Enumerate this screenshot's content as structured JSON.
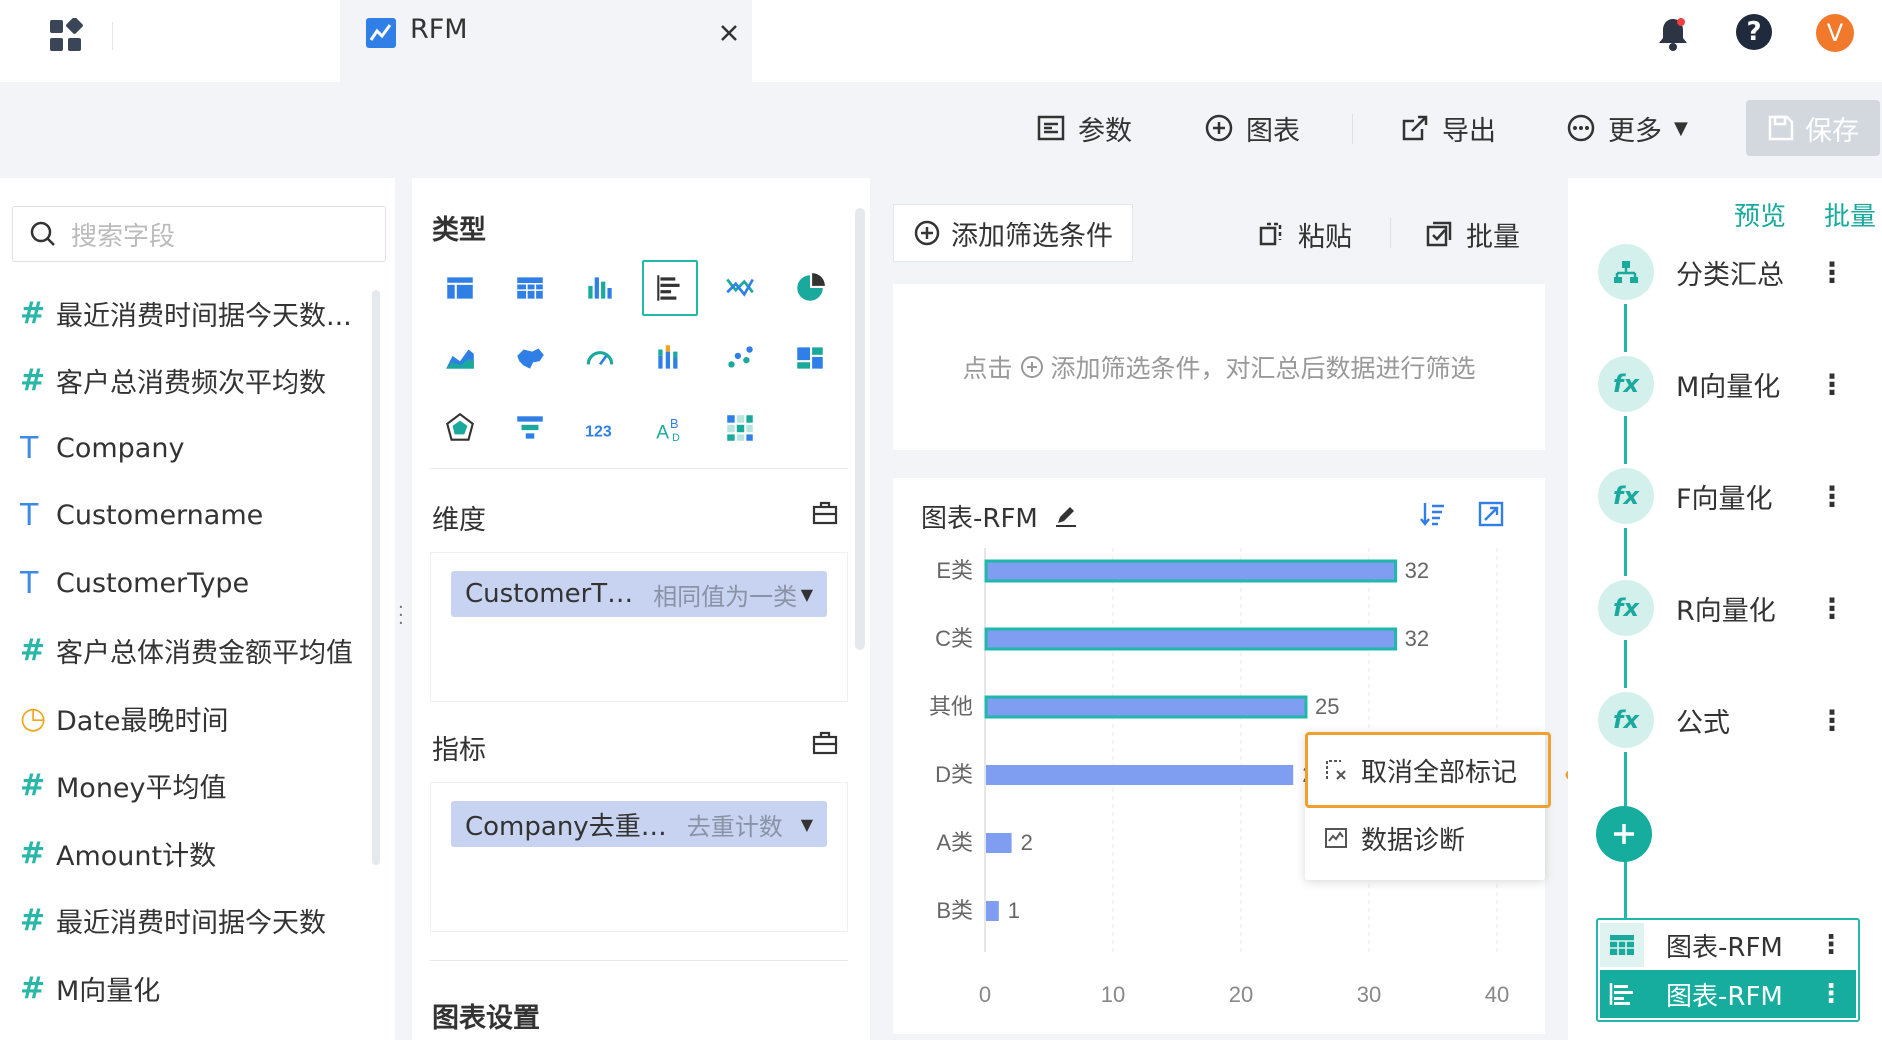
{
  "tab": {
    "title": "RFM"
  },
  "user": {
    "avatar_letter": "V"
  },
  "toolbar": {
    "params_label": "参数",
    "chart_label": "图表",
    "export_label": "导出",
    "more_label": "更多",
    "save_label": "保存"
  },
  "search": {
    "placeholder": "搜索字段"
  },
  "fields": [
    {
      "type": "number",
      "label": "最近消费时间据今天数..."
    },
    {
      "type": "number",
      "label": "客户总消费频次平均数"
    },
    {
      "type": "text-geo",
      "label": "Company"
    },
    {
      "type": "text",
      "label": "Customername"
    },
    {
      "type": "text-geo",
      "label": "CustomerType"
    },
    {
      "type": "number",
      "label": "客户总体消费金额平均值"
    },
    {
      "type": "date",
      "label": "Date最晚时间"
    },
    {
      "type": "number",
      "label": "Money平均值"
    },
    {
      "type": "number",
      "label": "Amount计数"
    },
    {
      "type": "number",
      "label": "最近消费时间据今天数"
    },
    {
      "type": "number",
      "label": "M向量化"
    }
  ],
  "middle": {
    "type_title": "类型",
    "dimension_title": "维度",
    "dimension_pill": {
      "main": "CustomerT…",
      "sub": "相同值为一类"
    },
    "metric_title": "指标",
    "metric_pill": {
      "main": "Company去重…",
      "sub": "去重计数"
    },
    "chart_settings_title": "图表设置"
  },
  "filter": {
    "add_label": "添加筛选条件",
    "paste_label": "粘贴",
    "batch_label": "批量",
    "hint_prefix": "点击",
    "hint_suffix": "添加筛选条件，对汇总后数据进行筛选"
  },
  "chart_card": {
    "title": "图表-RFM"
  },
  "chart_data": {
    "type": "bar",
    "orientation": "horizontal",
    "categories": [
      "E类",
      "C类",
      "其他",
      "D类",
      "A类",
      "B类"
    ],
    "values": [
      32,
      32,
      25,
      24,
      2,
      1
    ],
    "marked": [
      true,
      true,
      true,
      false,
      false,
      false
    ],
    "xticks": [
      "0",
      "10",
      "20",
      "30",
      "40"
    ],
    "xlim": [
      0,
      40
    ],
    "bar_color": "#7f9ef2",
    "mark_color": "#1fb8aa",
    "grid": true
  },
  "context_menu": {
    "items": [
      {
        "label": "取消全部标记",
        "icon": "unmark-icon"
      },
      {
        "label": "数据诊断",
        "icon": "diagnose-icon"
      }
    ]
  },
  "right": {
    "preview_label": "预览",
    "batch_label": "批量",
    "steps": [
      {
        "label": "分类汇总",
        "icon": "group-icon"
      },
      {
        "label": "M向量化",
        "icon": "fx-icon"
      },
      {
        "label": "F向量化",
        "icon": "fx-icon"
      },
      {
        "label": "R向量化",
        "icon": "fx-icon"
      },
      {
        "label": "公式",
        "icon": "fx-icon"
      }
    ],
    "outputs": [
      {
        "label": "图表-RFM",
        "icon": "table-icon"
      },
      {
        "label": "图表-RFM",
        "icon": "bar-chart-icon"
      }
    ]
  },
  "colors": {
    "accent": "#1fb8aa",
    "highlight": "#f0a030",
    "avatar": "#f2782b"
  }
}
